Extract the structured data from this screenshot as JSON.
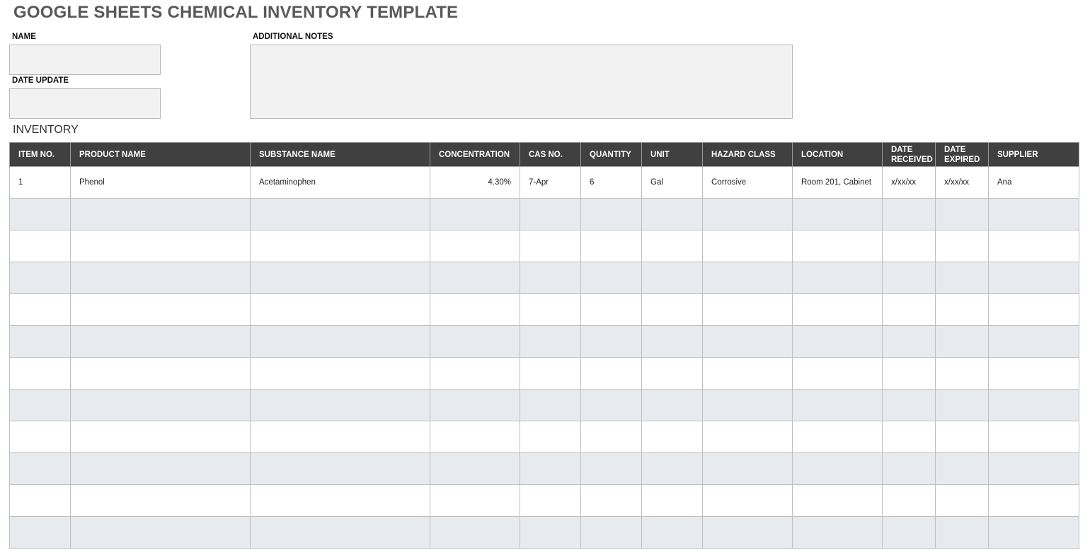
{
  "title": "GOOGLE SHEETS CHEMICAL INVENTORY TEMPLATE",
  "form": {
    "name_label": "NAME",
    "name_value": "",
    "date_update_label": "DATE UPDATE",
    "date_update_value": "",
    "notes_label": "ADDITIONAL NOTES",
    "notes_value": ""
  },
  "inventory": {
    "section_title": "INVENTORY",
    "columns": [
      "ITEM NO.",
      "PRODUCT NAME",
      "SUBSTANCE NAME",
      "CONCENTRATION",
      "CAS NO.",
      "QUANTITY",
      "UNIT",
      "HAZARD CLASS",
      "LOCATION",
      "DATE RECEIVED",
      "DATE EXPIRED",
      "SUPPLIER"
    ],
    "rows": [
      [
        "1",
        "Phenol",
        "Acetaminophen",
        "4.30%",
        "7-Apr",
        "6",
        "Gal",
        "Corrosive",
        "Room 201, Cabinet",
        "x/xx/xx",
        "x/xx/xx",
        "Ana"
      ],
      [
        "",
        "",
        "",
        "",
        "",
        "",
        "",
        "",
        "",
        "",
        "",
        ""
      ],
      [
        "",
        "",
        "",
        "",
        "",
        "",
        "",
        "",
        "",
        "",
        "",
        ""
      ],
      [
        "",
        "",
        "",
        "",
        "",
        "",
        "",
        "",
        "",
        "",
        "",
        ""
      ],
      [
        "",
        "",
        "",
        "",
        "",
        "",
        "",
        "",
        "",
        "",
        "",
        ""
      ],
      [
        "",
        "",
        "",
        "",
        "",
        "",
        "",
        "",
        "",
        "",
        "",
        ""
      ],
      [
        "",
        "",
        "",
        "",
        "",
        "",
        "",
        "",
        "",
        "",
        "",
        ""
      ],
      [
        "",
        "",
        "",
        "",
        "",
        "",
        "",
        "",
        "",
        "",
        "",
        ""
      ],
      [
        "",
        "",
        "",
        "",
        "",
        "",
        "",
        "",
        "",
        "",
        "",
        ""
      ],
      [
        "",
        "",
        "",
        "",
        "",
        "",
        "",
        "",
        "",
        "",
        "",
        ""
      ],
      [
        "",
        "",
        "",
        "",
        "",
        "",
        "",
        "",
        "",
        "",
        "",
        ""
      ],
      [
        "",
        "",
        "",
        "",
        "",
        "",
        "",
        "",
        "",
        "",
        "",
        ""
      ]
    ]
  }
}
